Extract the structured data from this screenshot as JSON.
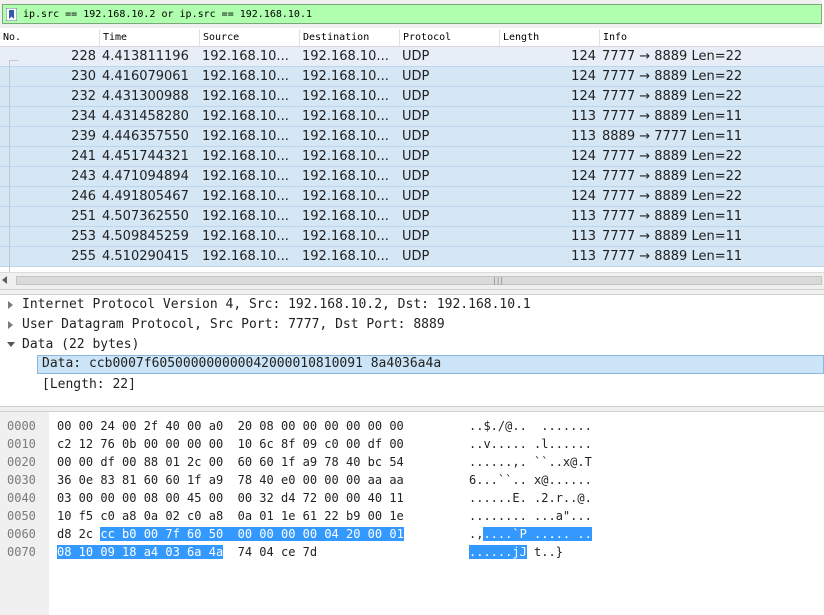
{
  "filter": {
    "text": "ip.src == 192.168.10.2 or ip.src == 192.168.10.1"
  },
  "packet_list": {
    "columns": [
      "No.",
      "Time",
      "Source",
      "Destination",
      "Protocol",
      "Length",
      "Info"
    ],
    "rows": [
      {
        "no": "228",
        "time": "4.413811196",
        "source": "192.168.10...",
        "destination": "192.168.10...",
        "protocol": "UDP",
        "length": "124",
        "info": "7777 → 8889 Len=22"
      },
      {
        "no": "230",
        "time": "4.416079061",
        "source": "192.168.10...",
        "destination": "192.168.10...",
        "protocol": "UDP",
        "length": "124",
        "info": "7777 → 8889 Len=22"
      },
      {
        "no": "232",
        "time": "4.431300988",
        "source": "192.168.10...",
        "destination": "192.168.10...",
        "protocol": "UDP",
        "length": "124",
        "info": "7777 → 8889 Len=22"
      },
      {
        "no": "234",
        "time": "4.431458280",
        "source": "192.168.10...",
        "destination": "192.168.10...",
        "protocol": "UDP",
        "length": "113",
        "info": "7777 → 8889 Len=11"
      },
      {
        "no": "239",
        "time": "4.446357550",
        "source": "192.168.10...",
        "destination": "192.168.10...",
        "protocol": "UDP",
        "length": "113",
        "info": "8889 → 7777 Len=11"
      },
      {
        "no": "241",
        "time": "4.451744321",
        "source": "192.168.10...",
        "destination": "192.168.10...",
        "protocol": "UDP",
        "length": "124",
        "info": "7777 → 8889 Len=22"
      },
      {
        "no": "243",
        "time": "4.471094894",
        "source": "192.168.10...",
        "destination": "192.168.10...",
        "protocol": "UDP",
        "length": "124",
        "info": "7777 → 8889 Len=22"
      },
      {
        "no": "246",
        "time": "4.491805467",
        "source": "192.168.10...",
        "destination": "192.168.10...",
        "protocol": "UDP",
        "length": "124",
        "info": "7777 → 8889 Len=22"
      },
      {
        "no": "251",
        "time": "4.507362550",
        "source": "192.168.10...",
        "destination": "192.168.10...",
        "protocol": "UDP",
        "length": "113",
        "info": "7777 → 8889 Len=11"
      },
      {
        "no": "253",
        "time": "4.509845259",
        "source": "192.168.10...",
        "destination": "192.168.10...",
        "protocol": "UDP",
        "length": "113",
        "info": "7777 → 8889 Len=11"
      },
      {
        "no": "255",
        "time": "4.510290415",
        "source": "192.168.10...",
        "destination": "192.168.10...",
        "protocol": "UDP",
        "length": "113",
        "info": "7777 → 8889 Len=11"
      }
    ],
    "selected_index": 0,
    "row_color": "#d5e6f5"
  },
  "details": {
    "ip_line": "Internet Protocol Version 4, Src: 192.168.10.2, Dst: 192.168.10.1",
    "udp_line": "User Datagram Protocol, Src Port: 7777, Dst Port: 8889",
    "data_line": "Data (22 bytes)",
    "data_value": "Data: ccb0007f605000000000042000010810091 8a4036a4a",
    "length_line": "[Length: 22]"
  },
  "bytes": {
    "offsets": [
      "0000",
      "0010",
      "0020",
      "0030",
      "0040",
      "0050",
      "0060",
      "0070"
    ],
    "lines": [
      {
        "hex": [
          "00 00 24 00 2f 40 00 a0  20 08 00 00 00 00 00 00",
          "",
          ""
        ],
        "ascii": [
          "..$./@..  .......",
          "",
          ""
        ]
      },
      {
        "hex": [
          "c2 12 76 0b 00 00 00 00  10 6c 8f 09 c0 00 df 00",
          "",
          ""
        ],
        "ascii": [
          "..v..... .l......",
          "",
          ""
        ]
      },
      {
        "hex": [
          "00 00 df 00 88 01 2c 00  60 60 1f a9 78 40 bc 54",
          "",
          ""
        ],
        "ascii": [
          "......,. ``..x@.T",
          "",
          ""
        ]
      },
      {
        "hex": [
          "36 0e 83 81 60 60 1f a9  78 40 e0 00 00 00 aa aa",
          "",
          ""
        ],
        "ascii": [
          "6...``.. x@......",
          "",
          ""
        ]
      },
      {
        "hex": [
          "03 00 00 00 08 00 45 00  00 32 d4 72 00 00 40 11",
          "",
          ""
        ],
        "ascii": [
          "......E. .2.r..@.",
          "",
          ""
        ]
      },
      {
        "hex": [
          "10 f5 c0 a8 0a 02 c0 a8  0a 01 1e 61 22 b9 00 1e",
          "",
          ""
        ],
        "ascii": [
          "........ ...a\"...",
          "",
          ""
        ]
      },
      {
        "hex": [
          "d8 2c ",
          "cc b0 00 7f 60 50  00 00 00 00 04 20 00 01",
          ""
        ],
        "ascii": [
          ".,",
          "....`P ..... ..",
          ""
        ]
      },
      {
        "hex": [
          "",
          "08 10 09 18 a4 03 6a 4a",
          "  74 04 ce 7d"
        ],
        "ascii": [
          "",
          "......jJ",
          " t..}"
        ]
      }
    ],
    "highlight_color": "#3399ff"
  }
}
